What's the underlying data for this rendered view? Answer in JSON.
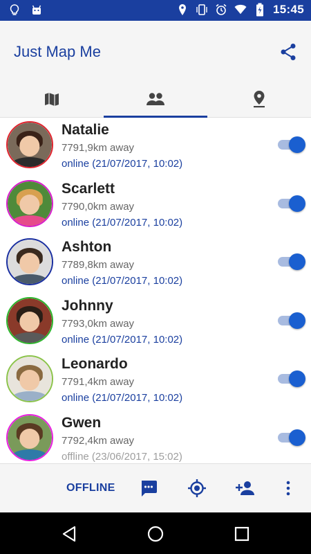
{
  "status_bar": {
    "time": "15:45",
    "icons": [
      "lightbulb-icon",
      "android-icon",
      "location-icon",
      "vibrate-icon",
      "alarm-icon",
      "wifi-icon",
      "battery-charging-icon"
    ],
    "background": "#1a3f9f"
  },
  "app_bar": {
    "title": "Just Map Me",
    "share_icon": "share-icon",
    "tabs": [
      {
        "icon": "map-icon",
        "active": false
      },
      {
        "icon": "people-icon",
        "active": true
      },
      {
        "icon": "place-icon",
        "active": false
      }
    ]
  },
  "contacts": [
    {
      "name": "Natalie",
      "distance": "7791,9km away",
      "status": "online (21/07/2017, 10:02)",
      "online": true,
      "ring": "#e0242e",
      "enabled": true
    },
    {
      "name": "Scarlett",
      "distance": "7790,0km away",
      "status": "online (21/07/2017, 10:02)",
      "online": true,
      "ring": "#d81bcb",
      "enabled": true
    },
    {
      "name": "Ashton",
      "distance": "7789,8km away",
      "status": "online (21/07/2017, 10:02)",
      "online": true,
      "ring": "#1a2fa0",
      "enabled": true
    },
    {
      "name": "Johnny",
      "distance": "7793,0km away",
      "status": "online (21/07/2017, 10:02)",
      "online": true,
      "ring": "#2bb52b",
      "enabled": true
    },
    {
      "name": "Leonardo",
      "distance": "7791,4km away",
      "status": "online (21/07/2017, 10:02)",
      "online": true,
      "ring": "#8bc34a",
      "enabled": true
    },
    {
      "name": "Gwen",
      "distance": "7792,4km away",
      "status": "offline (23/06/2017, 15:02)",
      "online": false,
      "ring": "#e91ee0",
      "enabled": true
    }
  ],
  "bottom_bar": {
    "offline_label": "OFFLINE",
    "actions": [
      "message-icon",
      "my-location-icon",
      "add-person-icon",
      "more-vert-icon"
    ]
  },
  "nav_bar": {
    "buttons": [
      "back-icon",
      "home-icon",
      "recents-icon"
    ]
  },
  "colors": {
    "accent": "#1a3f9f",
    "toggle_thumb": "#1a5fd0",
    "toggle_track": "#a8bbe0"
  }
}
